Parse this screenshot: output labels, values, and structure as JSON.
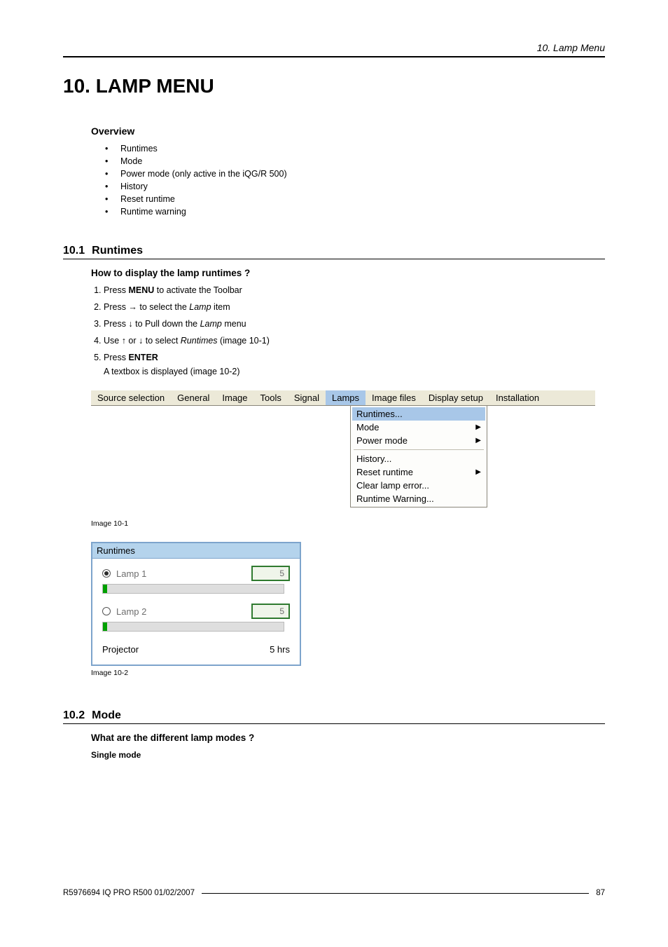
{
  "header": {
    "section_label": "10.  Lamp Menu"
  },
  "chapter": {
    "title": "10.  LAMP MENU"
  },
  "overview": {
    "heading": "Overview",
    "items": [
      "Runtimes",
      "Mode",
      "Power mode (only active in the iQG/R 500)",
      "History",
      "Reset runtime",
      "Runtime warning"
    ]
  },
  "section_runtimes": {
    "num": "10.1",
    "title": "Runtimes",
    "sub_heading": "How to display the lamp runtimes ?",
    "steps": [
      {
        "prefix": "Press ",
        "bold": "MENU",
        "suffix": " to activate the Toolbar"
      },
      {
        "prefix": "Press → to select the ",
        "italic": "Lamp",
        "suffix": " item"
      },
      {
        "prefix": "Press ↓ to Pull down the ",
        "italic": "Lamp",
        "suffix": " menu"
      },
      {
        "prefix": "Use ↑ or ↓ to select ",
        "italic": "Runtimes",
        "suffix": " (image 10-1)"
      },
      {
        "prefix": "Press ",
        "bold": "ENTER",
        "suffix": "",
        "sub": "A textbox is displayed (image 10-2)"
      }
    ]
  },
  "menubar": {
    "items": [
      "Source selection",
      "General",
      "Image",
      "Tools",
      "Signal",
      "Lamps",
      "Image files",
      "Display setup",
      "Installation"
    ],
    "selected_index": 5
  },
  "dropdown": {
    "items": [
      {
        "label": "Runtimes...",
        "selected": true,
        "submenu": false
      },
      {
        "label": "Mode",
        "submenu": true
      },
      {
        "label": "Power mode",
        "submenu": true
      },
      {
        "sep": true
      },
      {
        "label": "History..."
      },
      {
        "label": "Reset runtime",
        "submenu": true
      },
      {
        "label": "Clear lamp error..."
      },
      {
        "label": "Runtime Warning..."
      }
    ]
  },
  "caption1": "Image 10-1",
  "runtimes_dialog": {
    "title": "Runtimes",
    "lamp1_label": "Lamp 1",
    "lamp1_value": "5",
    "lamp2_label": "Lamp 2",
    "lamp2_value": "5",
    "projector_label": "Projector",
    "projector_value": "5 hrs"
  },
  "caption2": "Image 10-2",
  "section_mode": {
    "num": "10.2",
    "title": "Mode",
    "sub_heading": "What are the different lamp modes ?",
    "mode_label": "Single mode"
  },
  "footer": {
    "doc": "R5976694  IQ PRO R500  01/02/2007",
    "page": "87"
  }
}
